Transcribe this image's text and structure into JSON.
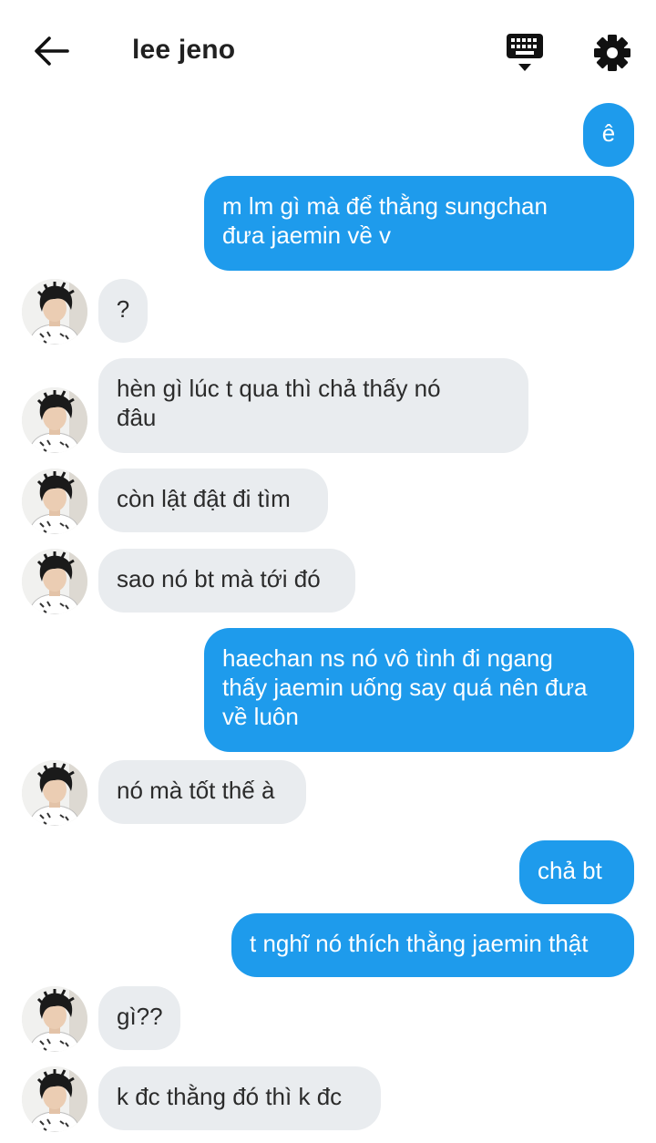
{
  "header": {
    "title": "lee jeno"
  },
  "messages": [
    {
      "side": "sent",
      "text": "ê"
    },
    {
      "side": "sent",
      "lines": [
        "m lm gì mà để thằng sungchan",
        "đưa jaemin về v"
      ]
    },
    {
      "side": "received",
      "text": "?"
    },
    {
      "side": "received",
      "lines": [
        "hèn gì lúc t qua thì chả thấy nó",
        "đâu"
      ]
    },
    {
      "side": "received",
      "text": "còn lật đật đi tìm"
    },
    {
      "side": "received",
      "text": "sao nó bt mà tới đó"
    },
    {
      "side": "sent",
      "lines": [
        "haechan ns nó vô tình đi ngang",
        "thấy jaemin uống say quá nên đưa",
        "về luôn"
      ]
    },
    {
      "side": "received",
      "text": "nó mà tốt thế à"
    },
    {
      "side": "sent",
      "text": "chả bt"
    },
    {
      "side": "sent",
      "text": "t nghĩ nó thích thằng jaemin thật"
    },
    {
      "side": "received",
      "text": "gì??"
    },
    {
      "side": "received",
      "text": "k đc thằng đó thì k đc"
    }
  ],
  "colors": {
    "sent_bubble": "#1e9bec",
    "received_bubble": "#e9ecef"
  }
}
